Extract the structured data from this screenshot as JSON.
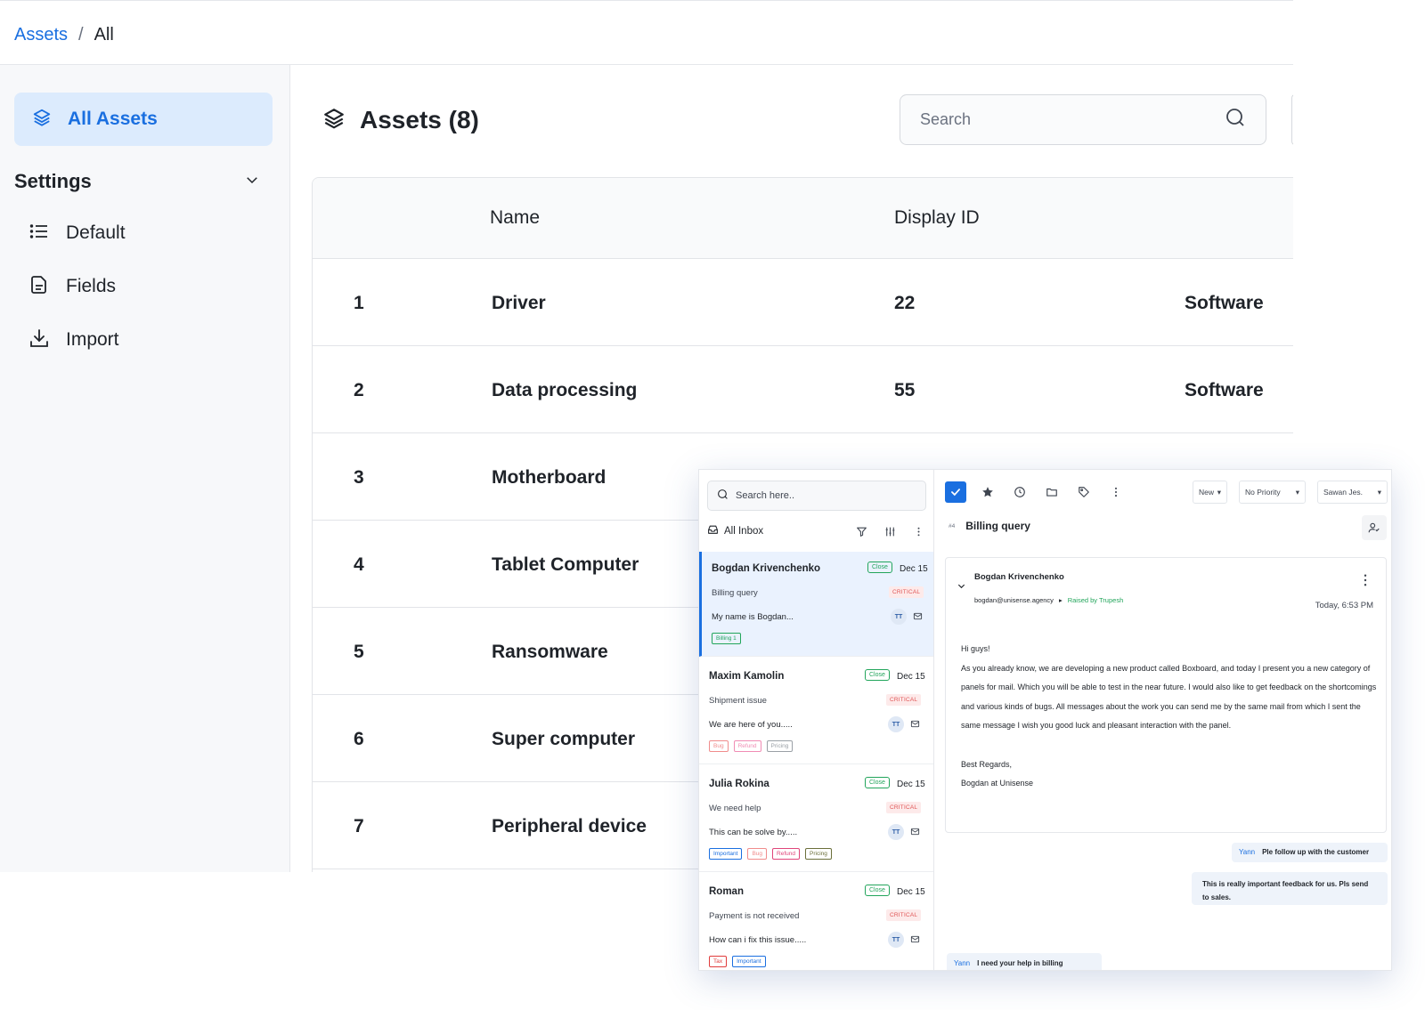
{
  "breadcrumb": {
    "root": "Assets",
    "separator": "/",
    "current": "All"
  },
  "sidebar": {
    "active": {
      "label": "All Assets"
    },
    "settings_label": "Settings",
    "items": [
      {
        "label": "Default",
        "icon": "list-icon"
      },
      {
        "label": "Fields",
        "icon": "file-icon"
      },
      {
        "label": "Import",
        "icon": "download-icon"
      }
    ]
  },
  "main": {
    "title": "Assets (8)",
    "search": {
      "placeholder": "Search",
      "value": ""
    },
    "table": {
      "columns": [
        "Name",
        "Display ID"
      ],
      "rows": [
        {
          "index": "1",
          "name": "Driver",
          "display_id": "22",
          "type": "Software"
        },
        {
          "index": "2",
          "name": "Data processing",
          "display_id": "55",
          "type": "Software"
        },
        {
          "index": "3",
          "name": "Motherboard",
          "display_id": "",
          "type": ""
        },
        {
          "index": "4",
          "name": "Tablet Computer",
          "display_id": "",
          "type": ""
        },
        {
          "index": "5",
          "name": "Ransomware",
          "display_id": "",
          "type": ""
        },
        {
          "index": "6",
          "name": "Super computer",
          "display_id": "",
          "type": ""
        },
        {
          "index": "7",
          "name": "Peripheral device",
          "display_id": "",
          "type": ""
        }
      ]
    }
  },
  "inbox": {
    "search_placeholder": "Search here..",
    "inbox_label": "All Inbox",
    "conversations": [
      {
        "name": "Bogdan Krivenchenko",
        "status": "Close",
        "date": "Dec 15",
        "subject": "Billing query",
        "priority": "CRITICAL",
        "preview": "My name is Bogdan...",
        "avatar": "TT",
        "tags": [
          {
            "label": "Billing 1",
            "color": "#22a55b"
          }
        ]
      },
      {
        "name": "Maxim Kamolin",
        "status": "Close",
        "date": "Dec 15",
        "subject": "Shipment issue",
        "priority": "CRITICAL",
        "preview": "We are here of you.....",
        "avatar": "TT",
        "tags": [
          {
            "label": "Bug",
            "color": "#f08c8c"
          },
          {
            "label": "Refund",
            "color": "#f08cb4"
          },
          {
            "label": "Pricing",
            "color": "#9aa0a6"
          }
        ]
      },
      {
        "name": "Julia Rokina",
        "status": "Close",
        "date": "Dec 15",
        "subject": "We need help",
        "priority": "CRITICAL",
        "preview": "This can be solve by.....",
        "avatar": "TT",
        "tags": [
          {
            "label": "Important",
            "color": "#1a6fe0"
          },
          {
            "label": "Bug",
            "color": "#f08c8c"
          },
          {
            "label": "Refund",
            "color": "#e0457a"
          },
          {
            "label": "Pricing",
            "color": "#6b6f3a"
          }
        ]
      },
      {
        "name": "Roman",
        "status": "Close",
        "date": "Dec 15",
        "subject": "Payment is not received",
        "priority": "CRITICAL",
        "preview": "How can i fix this issue.....",
        "avatar": "TT",
        "tags": [
          {
            "label": "Tax",
            "color": "#e03c3c"
          },
          {
            "label": "Important",
            "color": "#1a6fe0"
          }
        ]
      }
    ],
    "toolbar": {
      "status": "New",
      "priority": "No Priority",
      "assignee": "Sawan Jes."
    },
    "ticket": {
      "number": "#4",
      "title": "Billing query"
    },
    "message": {
      "from": "Bogdan Krivenchenko",
      "email": "bogdan@unisense.agency",
      "raised_by": "Raised by Trupesh",
      "time": "Today, 6:53 PM",
      "greeting": "Hi guys!",
      "body": "As you already know, we are developing a new product called Boxboard, and today I present you a new category of panels for mail. Which you will be able to test in the near future. I would also like to get feedback on the shortcomings and various kinds of bugs. All messages about the work you can send me by the same mail from which I sent the same message I wish you good luck and pleasant interaction with the panel.",
      "signoff": "Best Regards,",
      "signature": "Bogdan at Unisense"
    },
    "notes": [
      {
        "author": "Yann",
        "text": "Ple follow up with the customer"
      },
      {
        "author": "",
        "text": "This is really important feedback for us. Pls send to sales."
      },
      {
        "author": "Yann",
        "text": "I need your help in billing"
      }
    ],
    "colors": {
      "accent": "#1a6fe0",
      "success": "#22a55b",
      "critical": "#e05454"
    }
  }
}
